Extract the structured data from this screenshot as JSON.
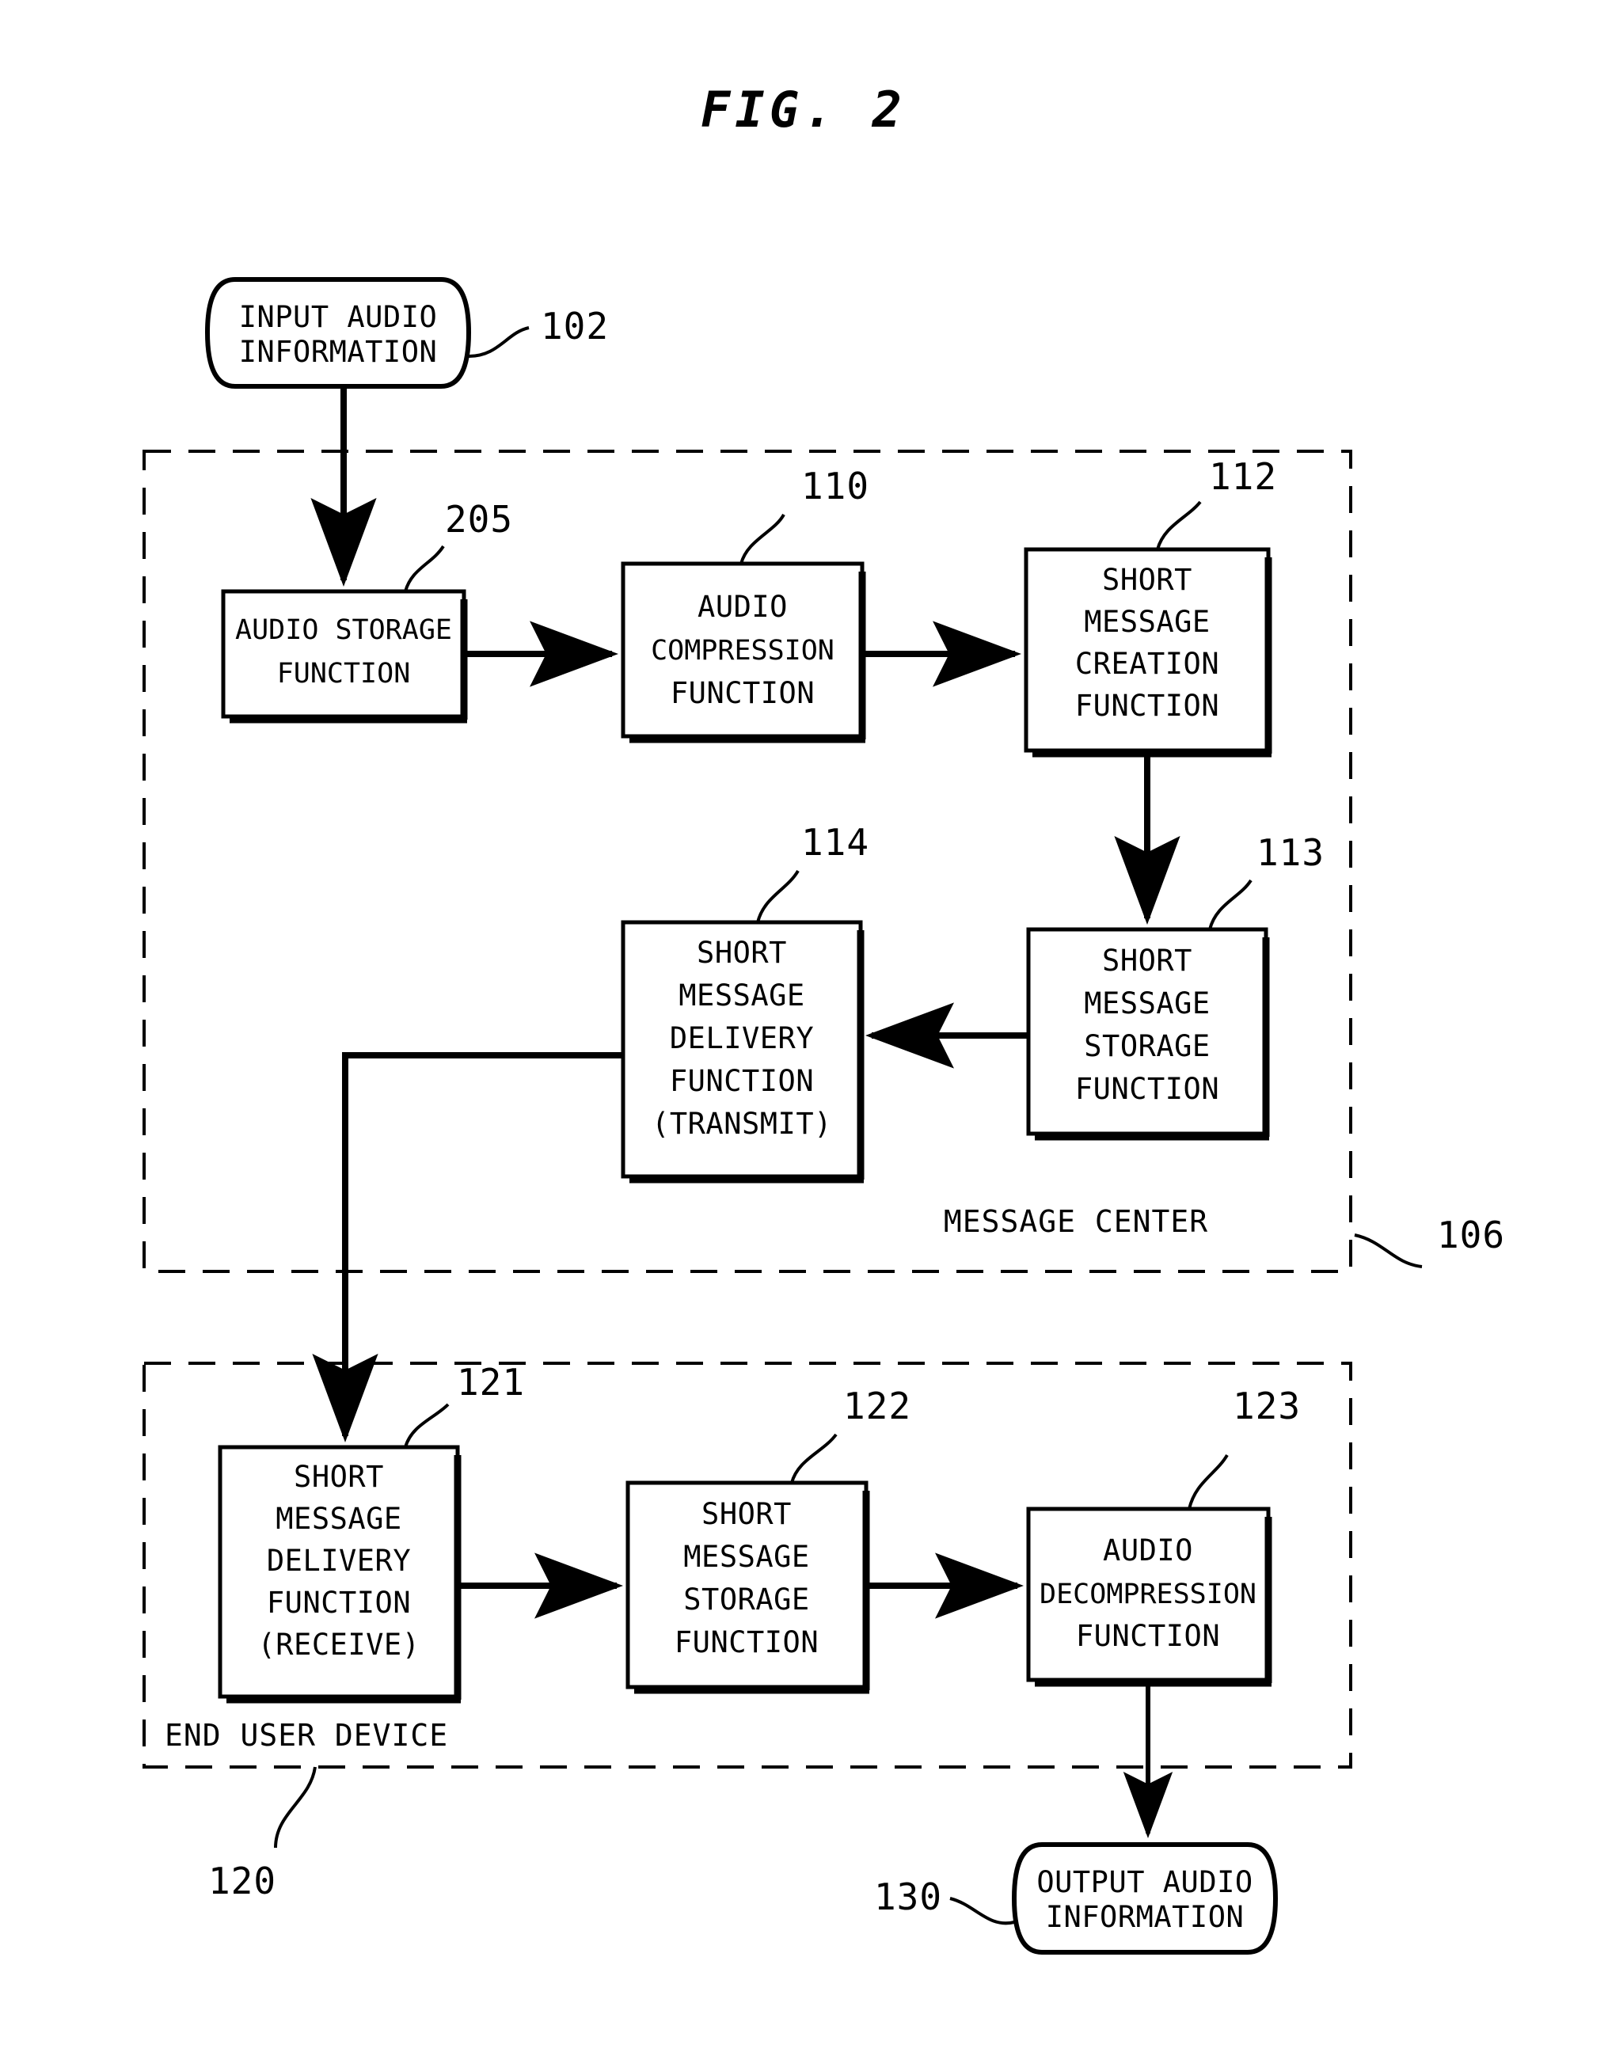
{
  "figure": {
    "title": "FIG. 2"
  },
  "terminals": [
    {
      "id": "input-audio",
      "lines": [
        "INPUT AUDIO",
        "INFORMATION"
      ],
      "ref": "102"
    },
    {
      "id": "output-audio",
      "lines": [
        "OUTPUT AUDIO",
        "INFORMATION"
      ],
      "ref": "130"
    }
  ],
  "zones": [
    {
      "id": "message-center",
      "label": "MESSAGE CENTER",
      "ref": "106"
    },
    {
      "id": "end-user-device",
      "label": "END USER DEVICE",
      "ref": "120"
    }
  ],
  "boxes": [
    {
      "id": "audio-storage-function",
      "lines": [
        "AUDIO STORAGE",
        "FUNCTION"
      ],
      "ref": "205",
      "zone": "message-center"
    },
    {
      "id": "audio-compression-function",
      "lines": [
        "AUDIO",
        "COMPRESSION",
        "FUNCTION"
      ],
      "ref": "110",
      "zone": "message-center"
    },
    {
      "id": "short-message-creation-function",
      "lines": [
        "SHORT",
        "MESSAGE",
        "CREATION",
        "FUNCTION"
      ],
      "ref": "112",
      "zone": "message-center"
    },
    {
      "id": "short-message-storage-function-mc",
      "lines": [
        "SHORT",
        "MESSAGE",
        "STORAGE",
        "FUNCTION"
      ],
      "ref": "113",
      "zone": "message-center"
    },
    {
      "id": "short-message-delivery-function-transmit",
      "lines": [
        "SHORT",
        "MESSAGE",
        "DELIVERY",
        "FUNCTION",
        "(TRANSMIT)"
      ],
      "ref": "114",
      "zone": "message-center"
    },
    {
      "id": "short-message-delivery-function-receive",
      "lines": [
        "SHORT",
        "MESSAGE",
        "DELIVERY",
        "FUNCTION",
        "(RECEIVE)"
      ],
      "ref": "121",
      "zone": "end-user-device"
    },
    {
      "id": "short-message-storage-function-eud",
      "lines": [
        "SHORT",
        "MESSAGE",
        "STORAGE",
        "FUNCTION"
      ],
      "ref": "122",
      "zone": "end-user-device"
    },
    {
      "id": "audio-decompression-function",
      "lines": [
        "AUDIO",
        "DECOMPRESSION",
        "FUNCTION"
      ],
      "ref": "123",
      "zone": "end-user-device"
    }
  ],
  "flow": [
    {
      "from": "input-audio",
      "to": "audio-storage-function"
    },
    {
      "from": "audio-storage-function",
      "to": "audio-compression-function"
    },
    {
      "from": "audio-compression-function",
      "to": "short-message-creation-function"
    },
    {
      "from": "short-message-creation-function",
      "to": "short-message-storage-function-mc"
    },
    {
      "from": "short-message-storage-function-mc",
      "to": "short-message-delivery-function-transmit"
    },
    {
      "from": "short-message-delivery-function-transmit",
      "to": "short-message-delivery-function-receive"
    },
    {
      "from": "short-message-delivery-function-receive",
      "to": "short-message-storage-function-eud"
    },
    {
      "from": "short-message-storage-function-eud",
      "to": "audio-decompression-function"
    },
    {
      "from": "audio-decompression-function",
      "to": "output-audio"
    }
  ],
  "colors": {
    "ink": "#000000",
    "paper": "#ffffff"
  }
}
